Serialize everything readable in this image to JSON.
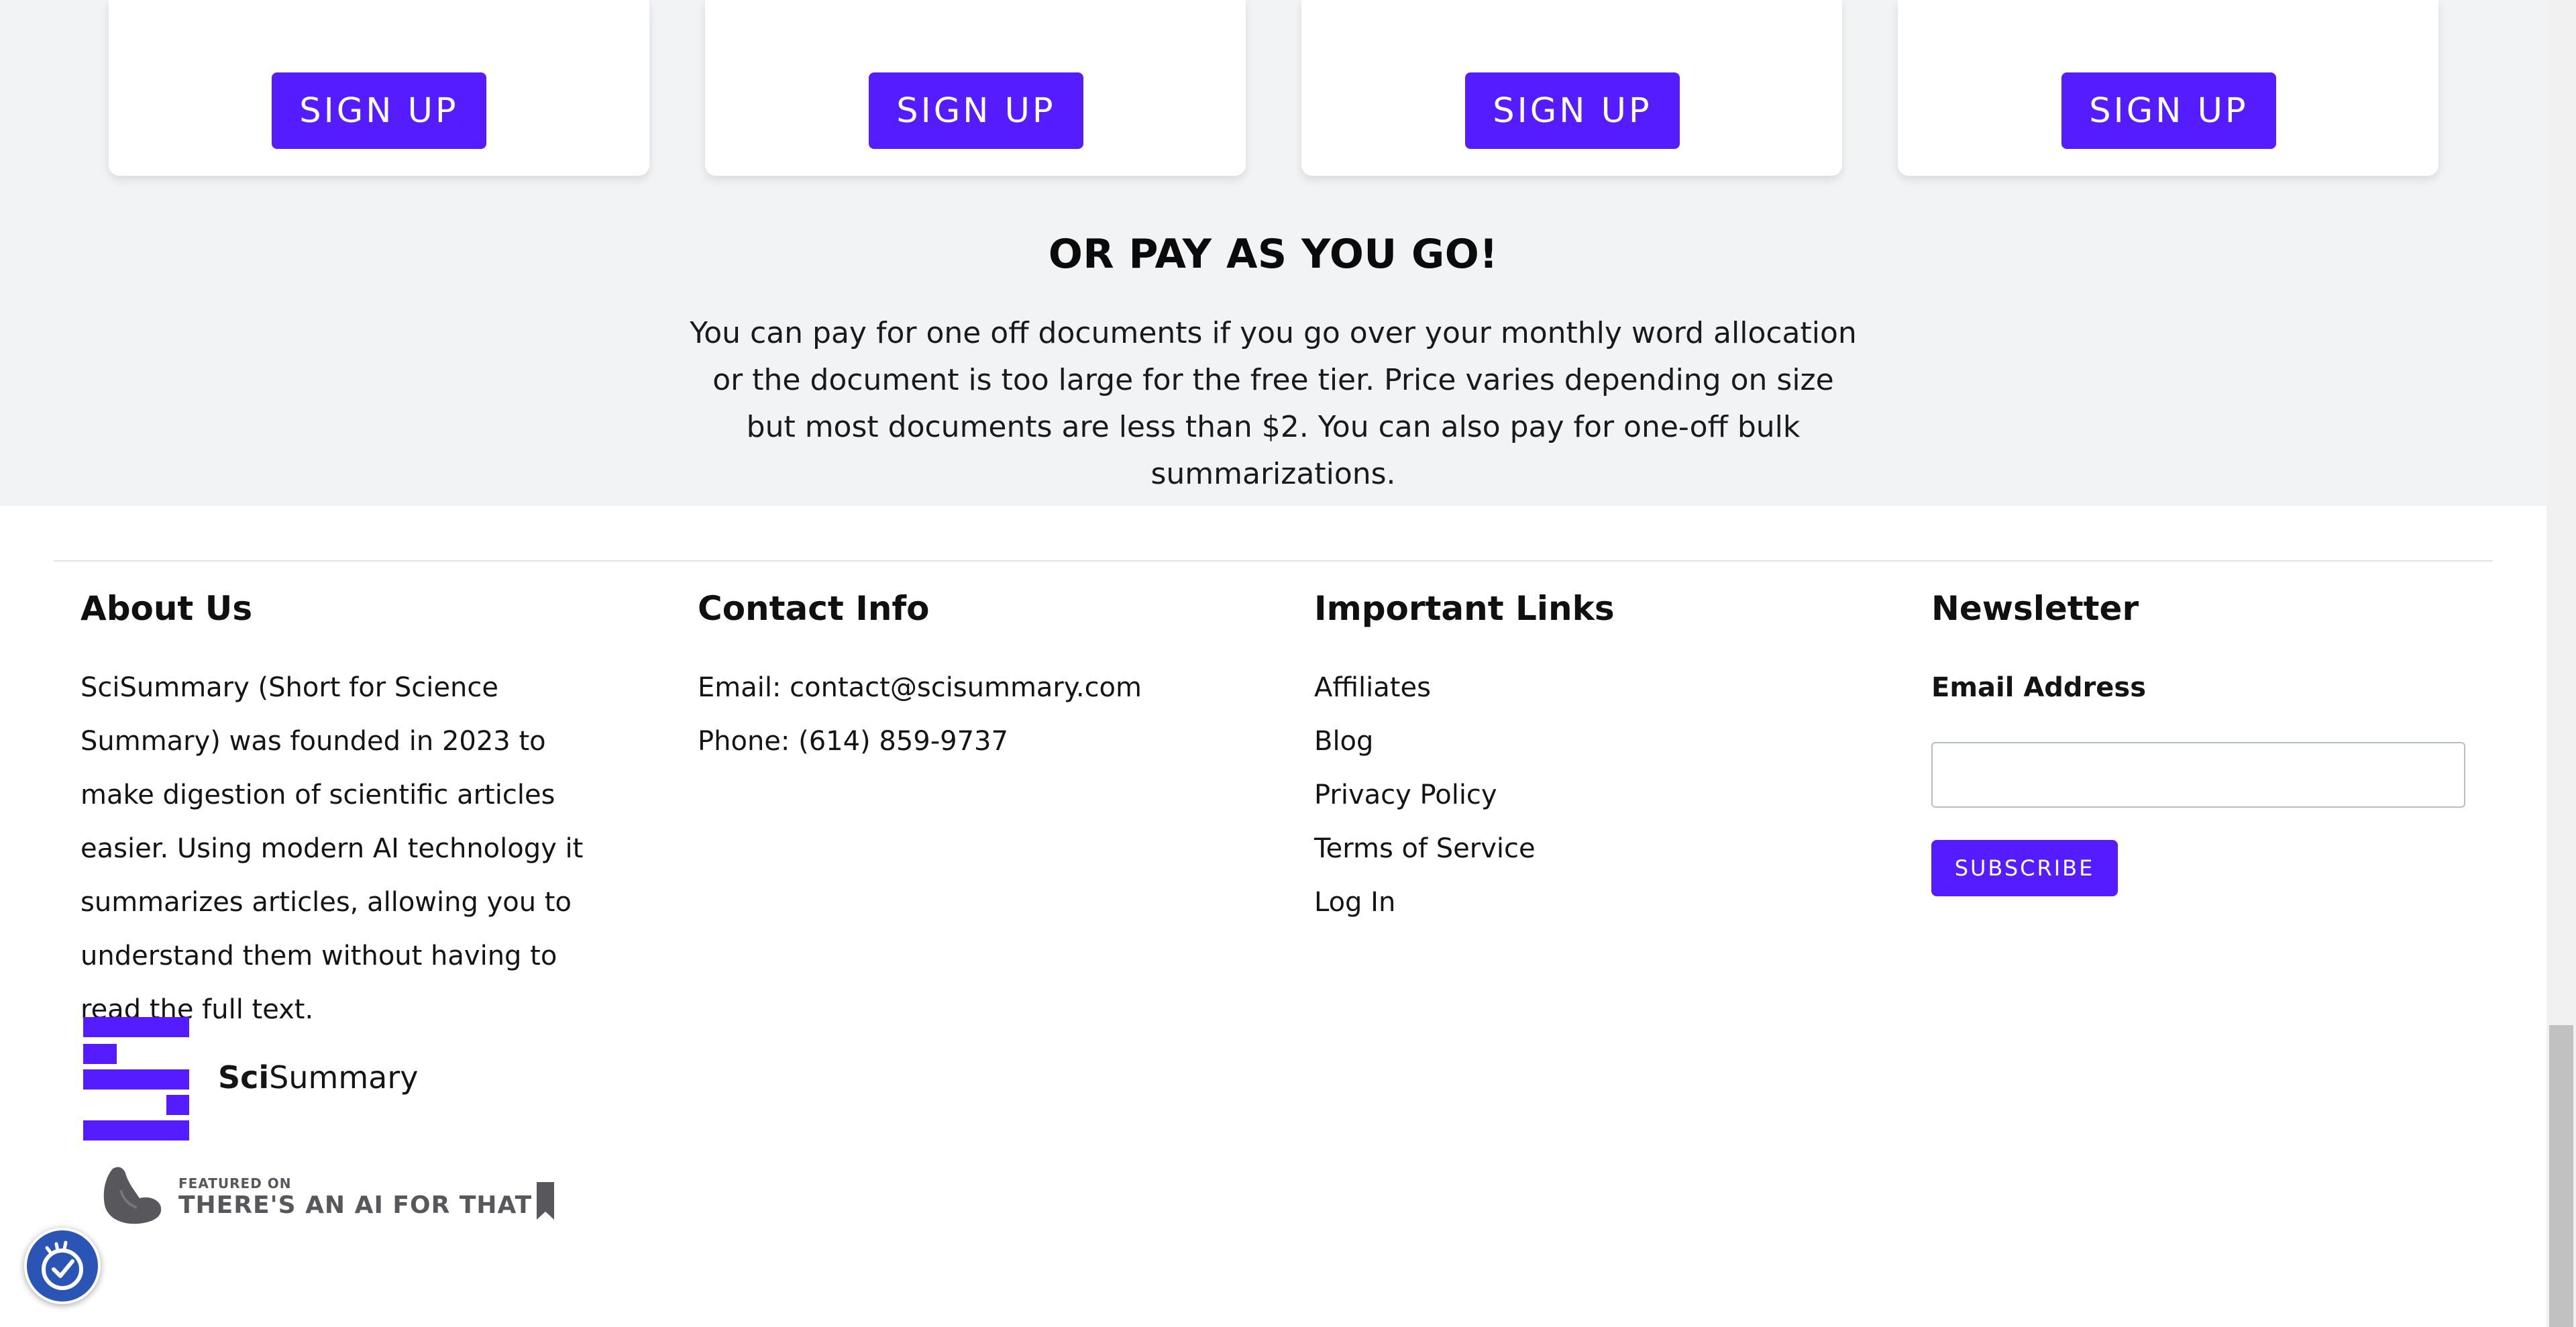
{
  "pricing": {
    "cards": [
      {
        "signup_label": "SIGN UP"
      },
      {
        "signup_label": "SIGN UP"
      },
      {
        "signup_label": "SIGN UP"
      },
      {
        "signup_label": "SIGN UP"
      }
    ],
    "payg_title": "OR PAY AS YOU GO!",
    "payg_text": "You can pay for one off documents if you go over your monthly word allocation or the document is too large for the free tier. Price varies depending on size but most documents are less than $2. You can also pay for one-off bulk summarizations."
  },
  "footer": {
    "about": {
      "title": "About Us",
      "text": "SciSummary (Short for Science Summary) was founded in 2023 to make digestion of scientific articles easier. Using modern AI technology it summarizes articles, allowing you to understand them without having to read the full text."
    },
    "contact": {
      "title": "Contact Info",
      "email": "Email: contact@scisummary.com",
      "phone": "Phone: (614) 859-9737"
    },
    "links": {
      "title": "Important Links",
      "items": [
        "Affiliates",
        "Blog",
        "Privacy Policy",
        "Terms of Service",
        "Log In"
      ]
    },
    "newsletter": {
      "title": "Newsletter",
      "email_label": "Email Address",
      "email_value": "",
      "subscribe_label": "SUBSCRIBE"
    },
    "logo": {
      "bold": "Sci",
      "rest": "Summary"
    },
    "badge": {
      "featured": "FEATURED ON",
      "name": "THERE'S AN AI FOR THAT"
    }
  },
  "colors": {
    "accent": "#541cfe",
    "band_background": "#f2f3f5",
    "accessibility_button": "#2a55b5"
  },
  "icons": {
    "accessibility": "accessibility-icon",
    "bookmark": "bookmark-icon",
    "arm": "flexed-arm-icon"
  }
}
